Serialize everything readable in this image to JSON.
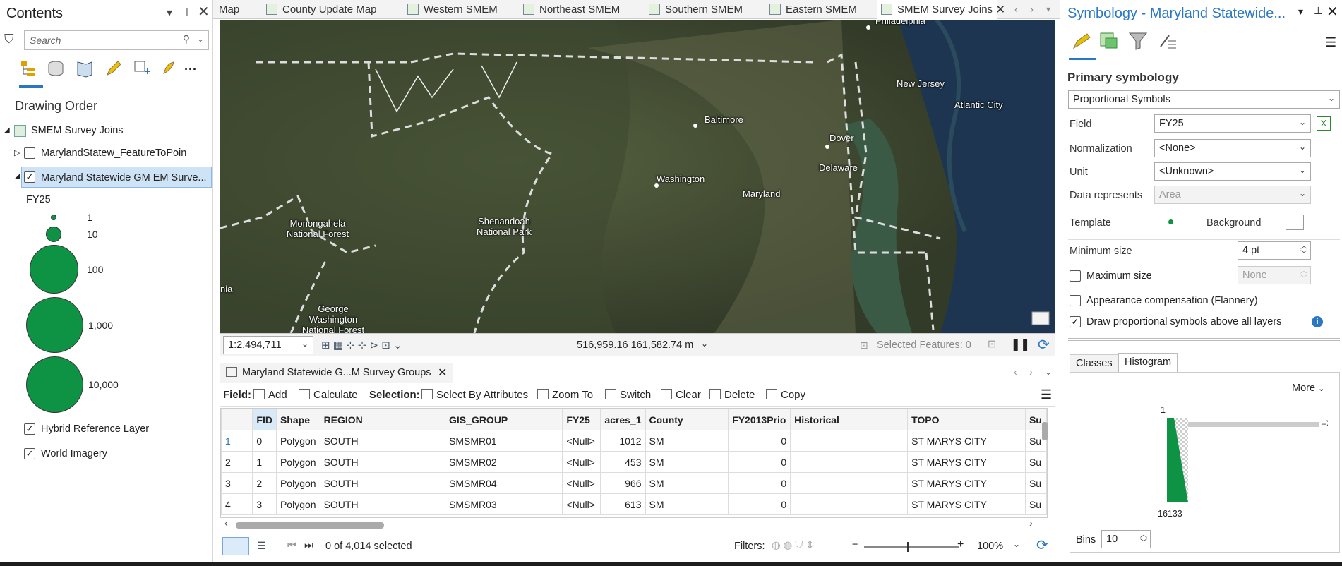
{
  "contents": {
    "title": "Contents",
    "search_placeholder": "Search",
    "drawing_order": "Drawing Order",
    "layers": {
      "map": "SMEM Survey Joins",
      "feature_to_point": "MarylandStatew_FeatureToPoin",
      "statewide": "Maryland Statewide GM EM Surve...",
      "hybrid": "Hybrid Reference Layer",
      "imagery": "World Imagery"
    },
    "legend_field": "FY25",
    "legend": [
      "1",
      "10",
      "100",
      "1,000",
      "10,000"
    ],
    "symbol_color": "#0e9345"
  },
  "tabs": [
    "Map",
    "County Update Map",
    "Western SMEM",
    "Northeast SMEM",
    "Southern SMEM",
    "Eastern SMEM",
    "SMEM Survey Joins"
  ],
  "map": {
    "labels": {
      "philadelphia": "Philadelphia",
      "nj": "New Jersey",
      "atlantic": "Atlantic City",
      "baltimore": "Baltimore",
      "dover": "Dover",
      "delaware": "Delaware",
      "washington": "Washington",
      "maryland": "Maryland",
      "monongahela": "Monongahela National Forest",
      "shenandoah": "Shenandoah National Park",
      "gw": "George Washington National Forest",
      "nia": "nia"
    },
    "scale": "1:2,494,711",
    "coords": "516,959.16 161,582.74 m",
    "selected": "Selected Features: 0"
  },
  "table": {
    "tab_title": "Maryland Statewide G...M Survey Groups",
    "field_label": "Field:",
    "add": "Add",
    "calculate": "Calculate",
    "selection_label": "Selection:",
    "select_by_attr": "Select By Attributes",
    "zoom_to": "Zoom To",
    "switch": "Switch",
    "clear": "Clear",
    "delete": "Delete",
    "copy": "Copy",
    "columns": [
      "FID",
      "Shape",
      "REGION",
      "GIS_GROUP",
      "FY25",
      "acres_1",
      "County",
      "FY2013Prio",
      "Historical",
      "TOPO",
      "Su"
    ],
    "rows": [
      [
        "1",
        "0",
        "Polygon",
        "SOUTH",
        "SMSMR01",
        "<Null>",
        "1012",
        "SM",
        "0",
        "",
        "ST MARYS CITY",
        "Su"
      ],
      [
        "2",
        "1",
        "Polygon",
        "SOUTH",
        "SMSMR02",
        "<Null>",
        "453",
        "SM",
        "0",
        "",
        "ST MARYS CITY",
        "Su"
      ],
      [
        "3",
        "2",
        "Polygon",
        "SOUTH",
        "SMSMR04",
        "<Null>",
        "966",
        "SM",
        "0",
        "",
        "ST MARYS CITY",
        "Su"
      ],
      [
        "4",
        "3",
        "Polygon",
        "SOUTH",
        "SMSMR03",
        "<Null>",
        "613",
        "SM",
        "0",
        "",
        "ST MARYS CITY",
        "Su"
      ]
    ],
    "selected_count": "0 of 4,014 selected",
    "filters": "Filters:",
    "zoom": "100%"
  },
  "symbology": {
    "title": "Symbology - Maryland Statewide...",
    "primary": "Primary symbology",
    "method": "Proportional Symbols",
    "field_label": "Field",
    "field_value": "FY25",
    "normalization_label": "Normalization",
    "normalization_value": "<None>",
    "unit_label": "Unit",
    "unit_value": "<Unknown>",
    "data_represents_label": "Data represents",
    "data_represents_value": "Area",
    "template_label": "Template",
    "background_label": "Background",
    "min_size_label": "Minimum size",
    "min_size_value": "4 pt",
    "max_size_label": "Maximum size",
    "max_size_value": "None",
    "flannery": "Appearance compensation (Flannery)",
    "draw_above": "Draw proportional symbols above all layers",
    "tab_classes": "Classes",
    "tab_histogram": "Histogram",
    "more": "More",
    "hist_top": "1",
    "hist_bottom": "16133",
    "bins_label": "Bins",
    "bins_value": "10"
  }
}
